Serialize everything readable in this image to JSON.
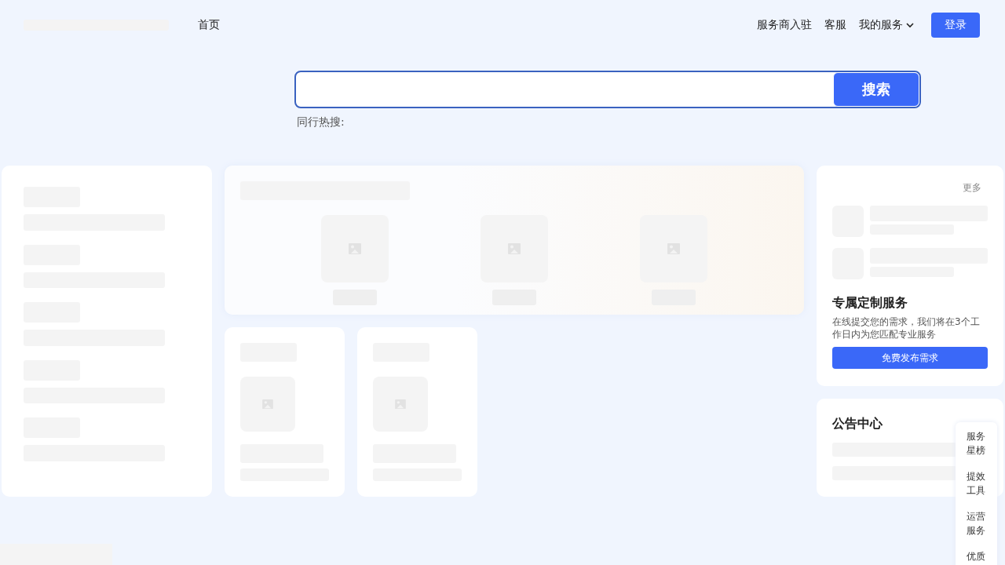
{
  "header": {
    "nav": [
      {
        "label": "首页"
      }
    ],
    "links": [
      {
        "label": "服务商入驻",
        "kind": "link"
      },
      {
        "label": "客服",
        "kind": "link"
      },
      {
        "label": "我的服务",
        "kind": "dropdown"
      }
    ],
    "login_button": "登录"
  },
  "search": {
    "button": "搜索",
    "hot_label": "同行热搜:"
  },
  "custom_card": {
    "more": "更多",
    "title": "专属定制服务",
    "description": "在线提交您的需求，我们将在3个工作日内为您匹配专业服务",
    "button": "免费发布需求"
  },
  "notice_card": {
    "title": "公告中心"
  },
  "float_bar": [
    {
      "label": "服务星榜"
    },
    {
      "label": "提效工具"
    },
    {
      "label": "运营服务"
    },
    {
      "label": "优质"
    }
  ]
}
